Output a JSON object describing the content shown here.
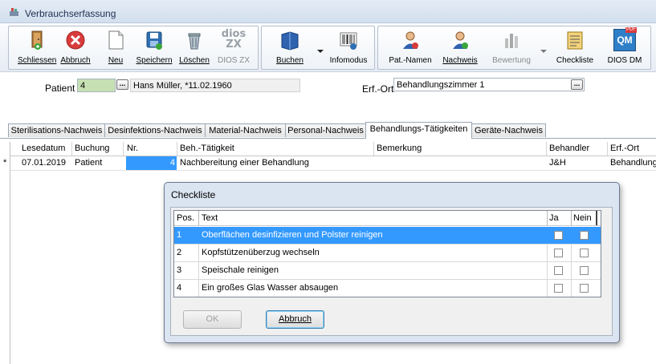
{
  "window": {
    "title": "Verbrauchserfassung",
    "icon": "app-icon"
  },
  "toolbar": {
    "buttons": [
      {
        "label": "Schliessen",
        "icon": "exit-door-icon"
      },
      {
        "label": "Abbruch",
        "icon": "cancel-icon"
      },
      {
        "label": "Neu",
        "icon": "new-document-icon"
      },
      {
        "label": "Speichern",
        "icon": "save-disk-icon"
      },
      {
        "label": "Löschen",
        "icon": "trash-icon"
      },
      {
        "label": "DIOS ZX",
        "icon": "dios-zx-logo-icon",
        "logo_text": "dios ZX"
      },
      {
        "label": "Buchen",
        "icon": "book-icon"
      },
      {
        "label": "Infomodus",
        "icon": "barcode-info-icon"
      },
      {
        "label": "Pat.-Namen",
        "icon": "patient-user-icon"
      },
      {
        "label": "Nachweis",
        "icon": "proof-user-icon"
      },
      {
        "label": "Bewertung",
        "icon": "rating-chart-icon"
      },
      {
        "label": "Checkliste",
        "icon": "checklist-icon"
      },
      {
        "label": "DIOS DM",
        "icon": "dios-dm-icon",
        "logo_text": "QM",
        "badge": "PDF"
      }
    ]
  },
  "form": {
    "patient_label": "Patient",
    "patient_id": "4",
    "patient_name": "Hans Müller, *11.02.1960",
    "ort_label": "Erf.-Ort",
    "ort_value": "Behandlungszimmer 1"
  },
  "tabs": [
    "Sterilisations-Nachweis",
    "Desinfektions-Nachweis",
    "Material-Nachweis",
    "Personal-Nachweis",
    "Behandlungs-Tätigkeiten",
    "Geräte-Nachweis"
  ],
  "active_tab": "Behandlungs-Tätigkeiten",
  "grid": {
    "columns": [
      "Lesedatum",
      "Buchung",
      "Nr.",
      "Beh.-Tätigkeit",
      "Bemerkung",
      "Behandler",
      "Erf.-Ort"
    ],
    "row_marker": "*",
    "rows": [
      {
        "lesedatum": "07.01.2019",
        "buchung": "Patient",
        "nr": "4",
        "taetigkeit": "Nachbereitung einer Behandlung",
        "bemerkung": "",
        "behandler": "J&H",
        "ort": "Behandlung"
      }
    ]
  },
  "dialog": {
    "title": "Checkliste",
    "columns": [
      "Pos.",
      "Text",
      "Ja",
      "Nein"
    ],
    "rows": [
      {
        "pos": "1",
        "text": "Oberflächen desinfizieren und Polster reinigen",
        "ja": false,
        "nein": false,
        "selected": true
      },
      {
        "pos": "2",
        "text": "Kopfstützenüberzug wechseln",
        "ja": false,
        "nein": false,
        "selected": false
      },
      {
        "pos": "3",
        "text": "Speischale reinigen",
        "ja": false,
        "nein": false,
        "selected": false
      },
      {
        "pos": "4",
        "text": "Ein großes Glas Wasser absaugen",
        "ja": false,
        "nein": false,
        "selected": false
      }
    ],
    "ok_label": "OK",
    "cancel_label": "Abbruch"
  },
  "colors": {
    "selection": "#3399ff",
    "nr_cell": "#3399ff",
    "patient_field": "#c6e0b4"
  }
}
